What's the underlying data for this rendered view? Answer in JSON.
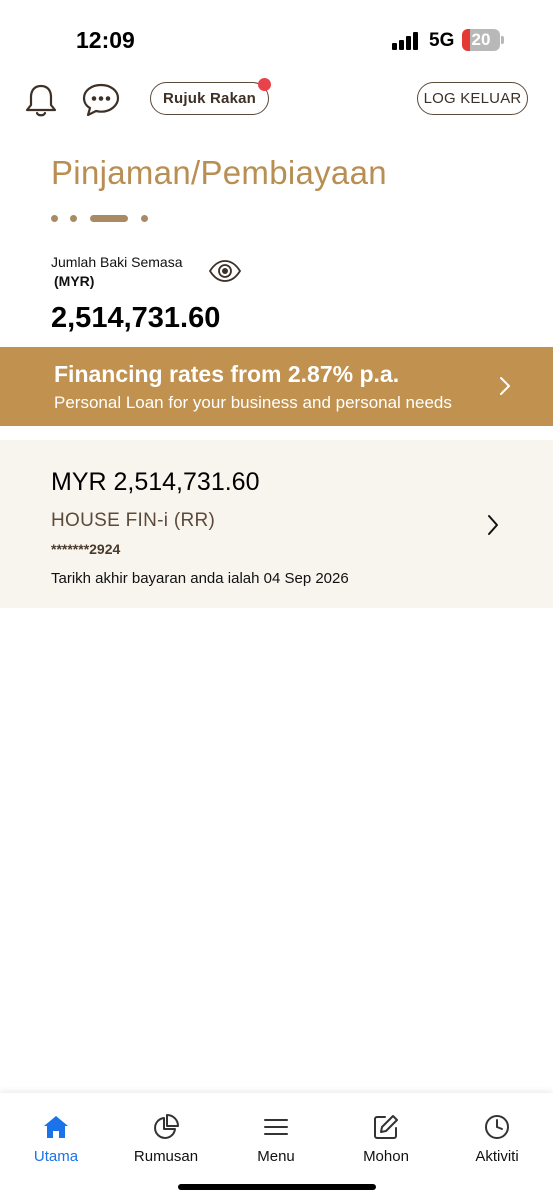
{
  "status_bar": {
    "time": "12:09",
    "network": "5G",
    "battery": "20"
  },
  "header": {
    "notification_icon": "bell-icon",
    "chat_icon": "chat-icon",
    "refer_label": "Rujuk Rakan",
    "logout_label": "LOG KELUAR"
  },
  "page": {
    "title": "Pinjaman/Pembiayaan",
    "balance_label": "Jumlah Baki Semasa",
    "balance_currency": "(MYR)",
    "balance_amount": "2,514,731.60"
  },
  "promo": {
    "title": "Financing rates from 2.87% p.a.",
    "subtitle": "Personal Loan for your business and personal needs"
  },
  "account": {
    "amount": "MYR 2,514,731.60",
    "product": "HOUSE FIN-i (RR)",
    "number": "*******2924",
    "due_text": "Tarikh akhir bayaran anda ialah 04 Sep 2026"
  },
  "nav": {
    "items": [
      {
        "label": "Utama",
        "icon": "home-icon",
        "active": true
      },
      {
        "label": "Rumusan",
        "icon": "pie-chart-icon",
        "active": false
      },
      {
        "label": "Menu",
        "icon": "menu-icon",
        "active": false
      },
      {
        "label": "Mohon",
        "icon": "edit-icon",
        "active": false
      },
      {
        "label": "Aktiviti",
        "icon": "clock-icon",
        "active": false
      }
    ]
  },
  "colors": {
    "accent": "#c0914f",
    "title": "#b98e52",
    "active_nav": "#1a73e8",
    "card_bg": "#f8f5ef",
    "badge": "#e8434a"
  }
}
